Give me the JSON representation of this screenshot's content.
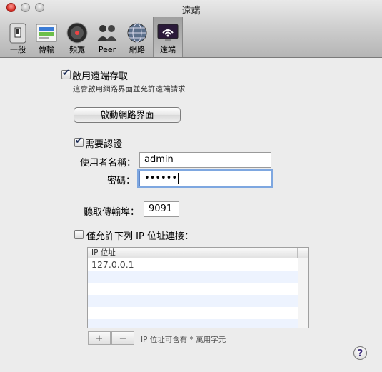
{
  "window": {
    "title": "遠端"
  },
  "toolbar": {
    "items": [
      {
        "label": "一般",
        "icon": "switch-icon"
      },
      {
        "label": "傳輸",
        "icon": "transfers-icon"
      },
      {
        "label": "頻寬",
        "icon": "speedometer-icon"
      },
      {
        "label": "Peer",
        "icon": "peers-icon"
      },
      {
        "label": "網路",
        "icon": "globe-icon"
      },
      {
        "label": "遠端",
        "icon": "remote-icon"
      }
    ],
    "selected": "遠端"
  },
  "remote": {
    "enable_label": "啟用遠端存取",
    "enable_desc": "這會啟用網路界面並允許遠端請求",
    "launch_button": "啟動網路界面",
    "auth_label": "需要認證",
    "username_label": "使用者名稱：",
    "username_value": "admin",
    "password_label": "密碼：",
    "password_value": "••••••",
    "port_label": "聽取傳輸埠：",
    "port_value": "9091",
    "iponly_label": "僅允許下列 IP 位址連接：",
    "ip_header": "IP 位址",
    "ip_rows": [
      "127.0.0.1",
      "",
      "",
      "",
      "",
      ""
    ],
    "add_label": "+",
    "remove_label": "−",
    "wildcard_hint": "IP 位址可含有 * 萬用字元",
    "help_label": "?"
  },
  "colors": {
    "accent": "#5c84c6",
    "close": "#d2261e",
    "row_alt": "#edf3fe"
  }
}
